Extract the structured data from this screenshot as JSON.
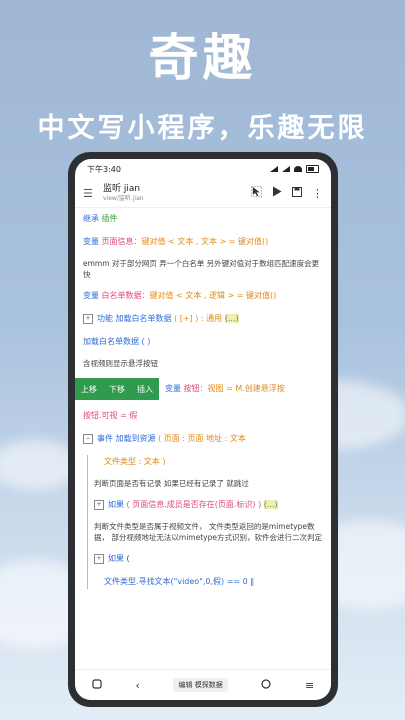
{
  "hero": {
    "title": "奇趣",
    "subtitle": "中文写小程序，乐趣无限"
  },
  "status": {
    "time": "下午3:40"
  },
  "appbar": {
    "title": "监听 jian",
    "subtitle": "view/监听.jian",
    "menu_icon": "hamburger-icon",
    "actions": [
      "cursor-icon",
      "play-icon",
      "save-icon",
      "more-icon"
    ]
  },
  "code": {
    "l1": {
      "kw": "继承",
      "name": "插件"
    },
    "l2": {
      "kw": "变量",
      "var": "页面信息",
      "rest": "：键对值 < 文本 , 文本 > = 键对值()"
    },
    "c1": "emmm 对于部分网页 弄一个白名单 另外键对值对于数组匹配速度会更快",
    "l3": {
      "kw": "变量",
      "var": "白名单数据",
      "rest": "：键对值 < 文本 , 逻辑 > = 键对值()"
    },
    "l4": {
      "kw": "功能",
      "fn": "加载白名单数据",
      "rest": "( [+] ) : 通用",
      "tail": "(...)"
    },
    "l5": "加载白名单数据 ( )",
    "c2": "含视频则显示悬浮按钮",
    "popup": {
      "up": "上移",
      "down": "下移",
      "insert": "插入"
    },
    "l6": {
      "kw": "变量",
      "var": "按钮",
      "rest": "：视图 = M.创建悬浮按"
    },
    "l7": "按钮.可视 = 假",
    "l8": {
      "kw": "事件",
      "fn": "加载到资源",
      "rest": "( 页面 : 页面  地址 : 文本"
    },
    "l9": "文件类型 : 文本 )",
    "c3": "判断页面是否有记录  如果已经有记录了 就跳过",
    "l10": {
      "kw": "如果",
      "rest": "( 页面信息.成员是否存在(页面.标识) )",
      "tail": "(...)"
    },
    "c4": "判断文件类型是否属于视频文件，  文件类型返回的是mimetype数据，  部分视频地址无法以mimetype方式识别，软件会进行二次判定",
    "l11": {
      "kw": "如果",
      "rest": "("
    },
    "l12": "文件类型.寻找文本(\"video\",0,假) == 0  ‖"
  },
  "navbar": {
    "edit_mode": "编辑 模探数据"
  },
  "colors": {
    "keyword": "#2f6bd8",
    "variable": "#e0457b",
    "type": "#e08a1a",
    "popup": "#2e9b4e"
  }
}
